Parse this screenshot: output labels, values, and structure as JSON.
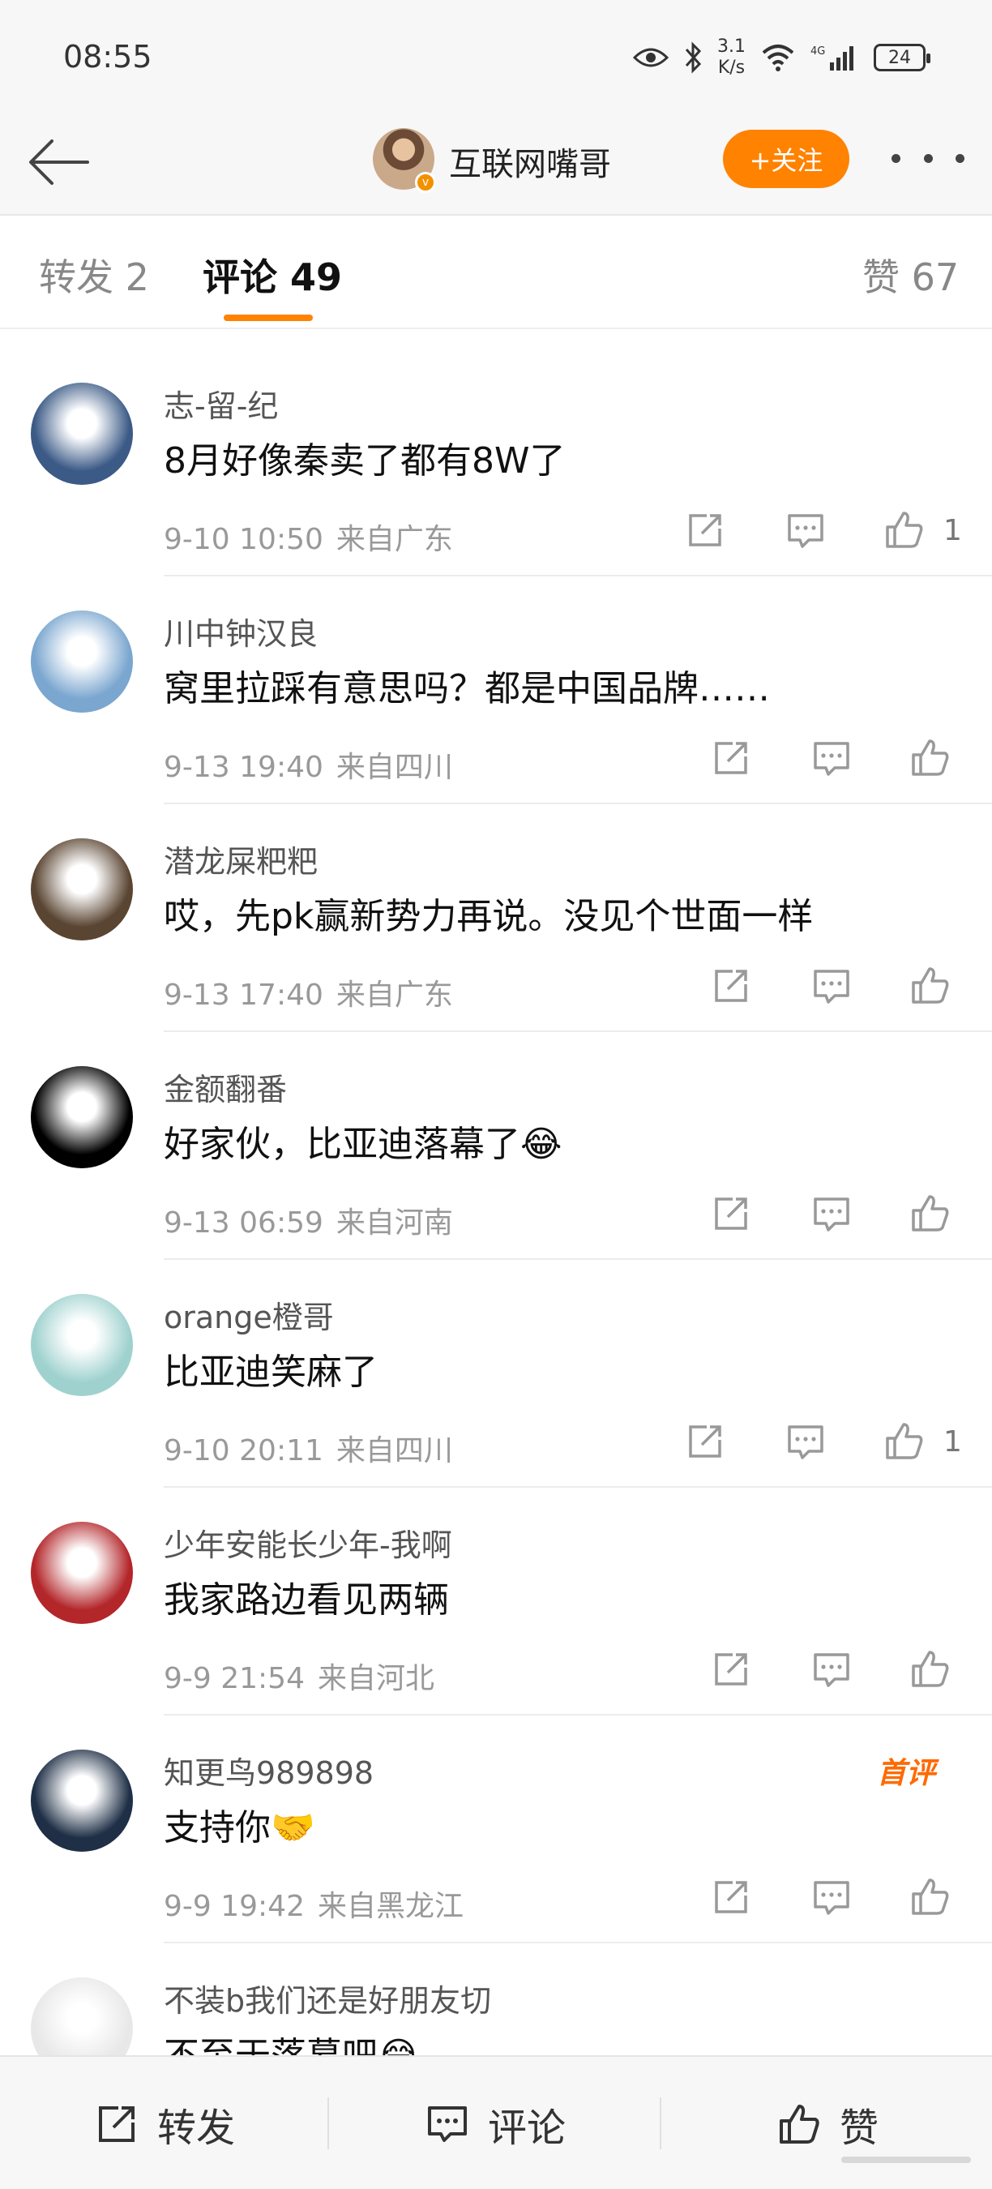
{
  "status_bar": {
    "time": "08:55",
    "net_speed_value": "3.1",
    "net_speed_unit": "K/s",
    "network": "4G",
    "battery": "24"
  },
  "nav": {
    "title": "互联网嘴哥",
    "follow_label": "+关注"
  },
  "tabs": {
    "repost": "转发 2",
    "comment": "评论 49",
    "like": "赞 67"
  },
  "comments": [
    {
      "user": "志-留-纪",
      "text": "8月好像秦卖了都有8W了",
      "time": "9-10 10:50",
      "location": "来自广东",
      "likes": "1",
      "avatar_color": "#3b5a86"
    },
    {
      "user": "川中钟汉良",
      "text": "窝里拉踩有意思吗？都是中国品牌……",
      "time": "9-13 19:40",
      "location": "来自四川",
      "likes": "",
      "avatar_color": "#7aa6cf"
    },
    {
      "user": "潜龙屎粑粑",
      "text": "哎，先pk赢新势力再说。没见个世面一样",
      "time": "9-13 17:40",
      "location": "来自广东",
      "likes": "",
      "avatar_color": "#5a4532"
    },
    {
      "user": "金额翻番",
      "text": "好家伙，比亚迪落幕了😂",
      "time": "9-13 06:59",
      "location": "来自河南",
      "likes": "",
      "avatar_color": "#000000"
    },
    {
      "user": "orange橙哥",
      "text": "比亚迪笑麻了",
      "time": "9-10 20:11",
      "location": "来自四川",
      "likes": "1",
      "avatar_color": "#9fd2cf"
    },
    {
      "user": "少年安能长少年-我啊",
      "text": "我家路边看见两辆",
      "time": "9-9 21:54",
      "location": "来自河北",
      "likes": "",
      "avatar_color": "#b3262a"
    },
    {
      "user": "知更鸟989898",
      "text": "支持你🤝",
      "time": "9-9 19:42",
      "location": "来自黑龙江",
      "likes": "",
      "avatar_color": "#1e2f46",
      "badge": "首评"
    },
    {
      "user": "不装b我们还是好朋友切",
      "text": "不至于落幕吧😂",
      "time": "",
      "location": "",
      "likes": "",
      "avatar_color": "#e8e8e8"
    }
  ],
  "bottom_bar": {
    "repost": "转发",
    "comment": "评论",
    "like": "赞"
  },
  "colors": {
    "accent": "#ff8200",
    "badge": "#ff6a00",
    "meta_text": "#999999"
  }
}
